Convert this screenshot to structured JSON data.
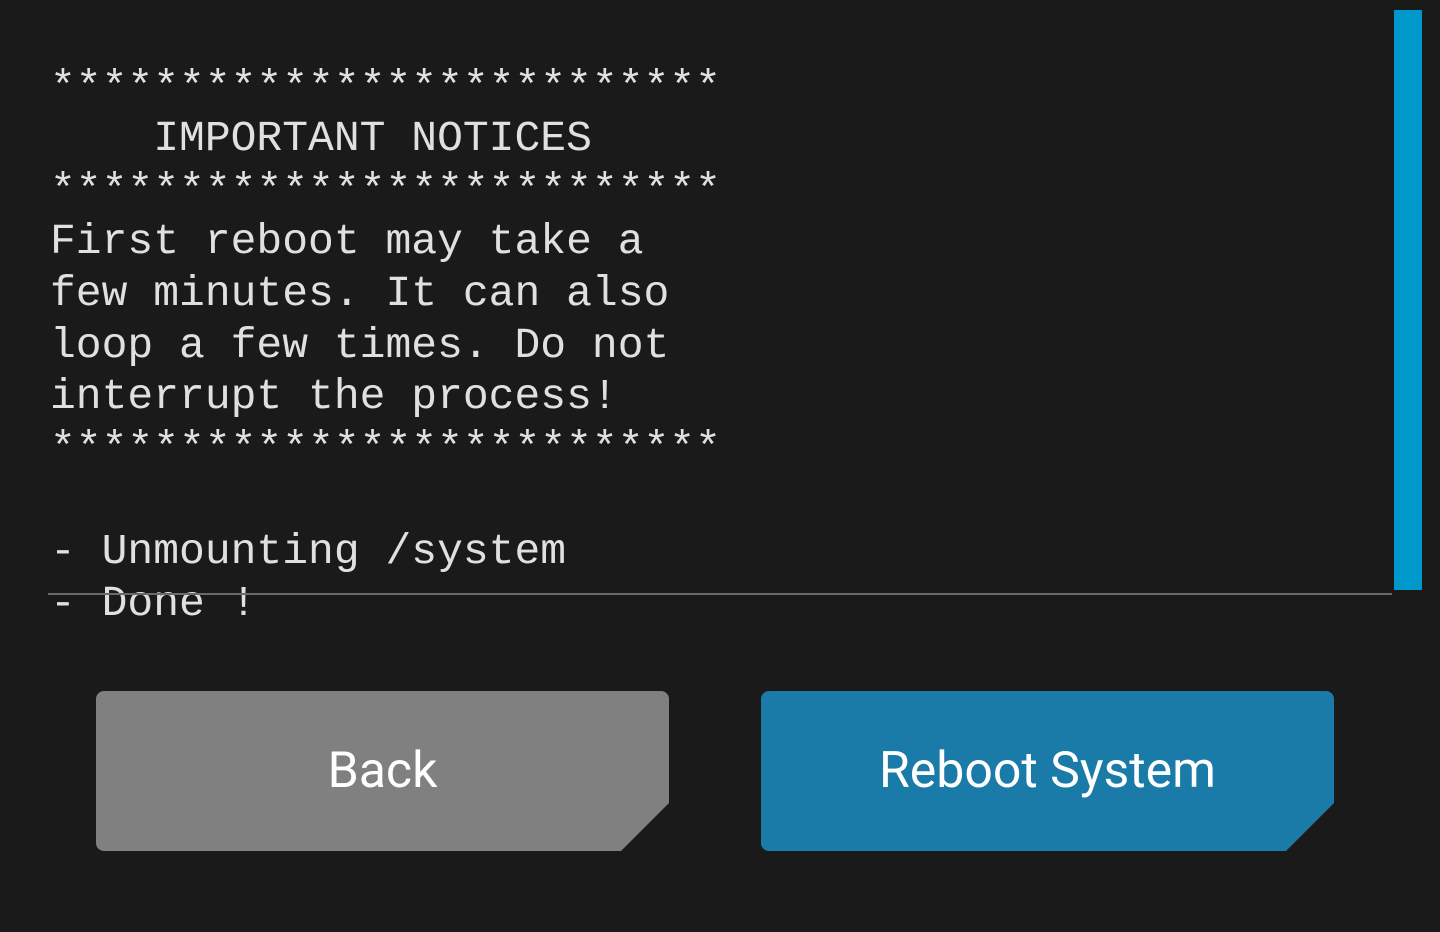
{
  "terminal": {
    "lines": [
      "**************************",
      "    IMPORTANT NOTICES",
      "**************************",
      "First reboot may take a",
      "few minutes. It can also",
      "loop a few times. Do not",
      "interrupt the process!",
      "**************************",
      "",
      "- Unmounting /system",
      "- Done !"
    ]
  },
  "buttons": {
    "back": "Back",
    "reboot": "Reboot System"
  }
}
